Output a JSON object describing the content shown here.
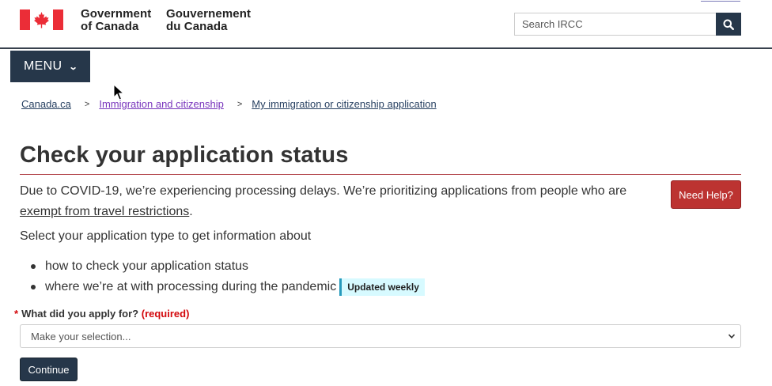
{
  "header": {
    "gov_en_line1": "Government",
    "gov_en_line2": "of Canada",
    "gov_fr_line1": "Gouvernement",
    "gov_fr_line2": "du Canada",
    "flag_icon": "canada-flag-icon"
  },
  "search": {
    "placeholder": "Search IRCC",
    "button_icon": "search-icon"
  },
  "menu": {
    "label": "MENU",
    "icon": "chevron-down-icon"
  },
  "breadcrumb": {
    "items": [
      "Canada.ca",
      "Immigration and citizenship",
      "My immigration or citizenship application"
    ],
    "separator": ">"
  },
  "main": {
    "title": "Check your application status",
    "notice_before": "Due to COVID-19, we’re experiencing processing delays. We’re prioritizing applications from people who are ",
    "notice_link": "exempt from travel restrictions",
    "notice_after": ".",
    "need_help": "Need Help?",
    "intro": "Select your application type to get information about",
    "bullets": [
      "how to check your application status",
      "where we’re at with processing during the pandemic"
    ],
    "badge": "Updated weekly"
  },
  "form": {
    "required_star": "*",
    "question": "What did you apply for?",
    "required_text": "(required)",
    "select_value": "Make your selection...",
    "continue_label": "Continue"
  },
  "colors": {
    "brand_navy": "#26374a",
    "danger_red": "#bc3331",
    "title_rule": "#af3c43",
    "badge_bg": "#d7faff"
  }
}
